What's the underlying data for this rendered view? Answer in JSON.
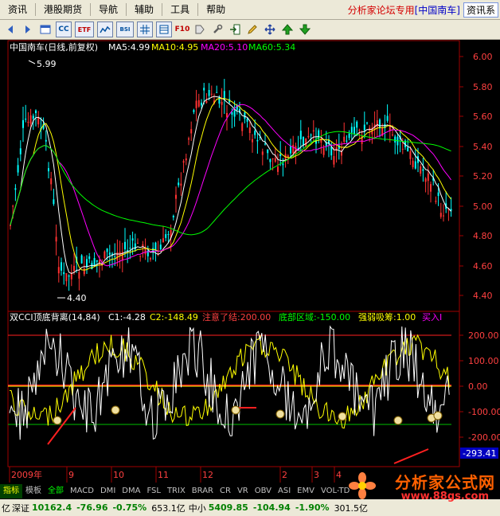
{
  "menu": {
    "items": [
      "资讯",
      "港股期货",
      "导航",
      "辅助",
      "工具",
      "帮助"
    ],
    "brand_prefix": "分析家论坛专用",
    "brand_name": "[中国南车]",
    "right_button": "资讯系"
  },
  "toolbar": {
    "icons": [
      "back-icon",
      "forward-icon",
      "window-icon",
      "cc-icon",
      "etf-icon",
      "line-chart-icon",
      "bsi-icon",
      "grid-icon",
      "table-icon",
      "f10-icon",
      "tag-icon",
      "wrench-icon",
      "enter-icon",
      "pencil-icon",
      "move-icon",
      "up-arrow-icon",
      "down-arrow-icon"
    ],
    "labels": {
      "cc": "CC",
      "etf": "ETF",
      "bsi": "BSI",
      "f10": "F10"
    }
  },
  "price_panel": {
    "title": "中国南车(日线,前复权)",
    "ma5": "MA5:4.99",
    "ma10": "MA10:4.95",
    "ma20": "MA20:5.10",
    "ma60": "MA60:5.34",
    "high_label": "5.99",
    "low_label": "4.40",
    "y_ticks": [
      "6.00",
      "5.80",
      "5.60",
      "5.40",
      "5.20",
      "5.00",
      "4.80",
      "4.60",
      "4.40"
    ],
    "colors": {
      "ma5": "#ffffff",
      "ma10": "#ffff00",
      "ma20": "#ff00ff",
      "ma60": "#00ff00",
      "up": "#ff3333",
      "down": "#00ffff"
    }
  },
  "indicator_panel": {
    "name": "双CCI顶底背离(14,84)",
    "c1": "C1:-4.28",
    "c2": "C2:-148.49",
    "warn": "注意了结:200.00",
    "bottom_zone": "底部区域:-150.00",
    "strong": "强弱吸筹:1.00",
    "buy": "买入I",
    "y_ticks": [
      "200.00",
      "100.00",
      "0.00",
      "-100.00",
      "-200.00"
    ],
    "current_value": "-293.41"
  },
  "x_axis": {
    "labels": [
      "2009年",
      "9",
      "10",
      "11",
      "12",
      "2",
      "3",
      "4"
    ]
  },
  "tabs": [
    "指标",
    "模板",
    "全部",
    "MACD",
    "DMI",
    "DMA",
    "FSL",
    "TRIX",
    "BRAR",
    "CR",
    "VR",
    "OBV",
    "ASI",
    "EMV",
    "VOL-TD"
  ],
  "status": {
    "prefix": "亿",
    "index1_name": "深证",
    "index1_value": "10162.4",
    "index1_change": "-76.96",
    "index1_pct": "-0.75%",
    "index1_amount": "653.1亿",
    "index2_name": "中小",
    "index2_value": "5409.85",
    "index2_change": "-104.94",
    "index2_pct": "-1.90%",
    "index2_amount": "301.5亿"
  },
  "watermark": {
    "title": "分析家公式网",
    "url": "www.88gs.com"
  }
}
